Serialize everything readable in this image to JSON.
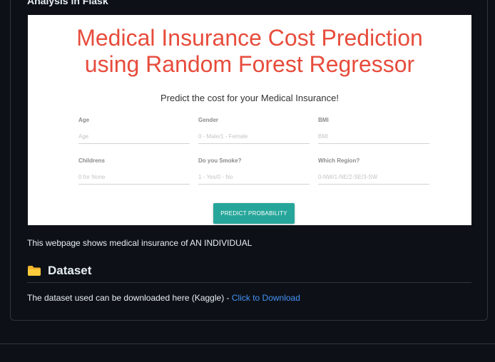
{
  "readme": {
    "cut_heading": "Analysis in Flask",
    "description": "This webpage shows medical insurance of AN INDIVIDUAL",
    "dataset_heading": "Dataset",
    "download_text": "The dataset used can be downloaded here (Kaggle) - ",
    "download_link": "Click to Download",
    "link_color": "#4493f8",
    "folder_icon": "folder-icon"
  },
  "app": {
    "title_line1": "Medical Insurance Cost Prediction",
    "title_line2": "using Random Forest Regressor",
    "subtitle": "Predict the cost for your Medical Insurance!",
    "title_color": "#e74c3c",
    "button_color": "#26a69a",
    "fields": [
      {
        "label": "Age",
        "placeholder": "Age",
        "value": ""
      },
      {
        "label": "Gender",
        "placeholder": "0 - Male/1 - Female",
        "value": ""
      },
      {
        "label": "BMI",
        "placeholder": "BMI",
        "value": ""
      },
      {
        "label": "Childrens",
        "placeholder": "0 for None",
        "value": ""
      },
      {
        "label": "Do you Smoke?",
        "placeholder": "1 - Yes/0 - No",
        "value": ""
      },
      {
        "label": "Which Region?",
        "placeholder": "0-NW/1-NE/2-SE/3-SW",
        "value": ""
      }
    ],
    "button_label": "PREDICT PROBABILITY"
  }
}
